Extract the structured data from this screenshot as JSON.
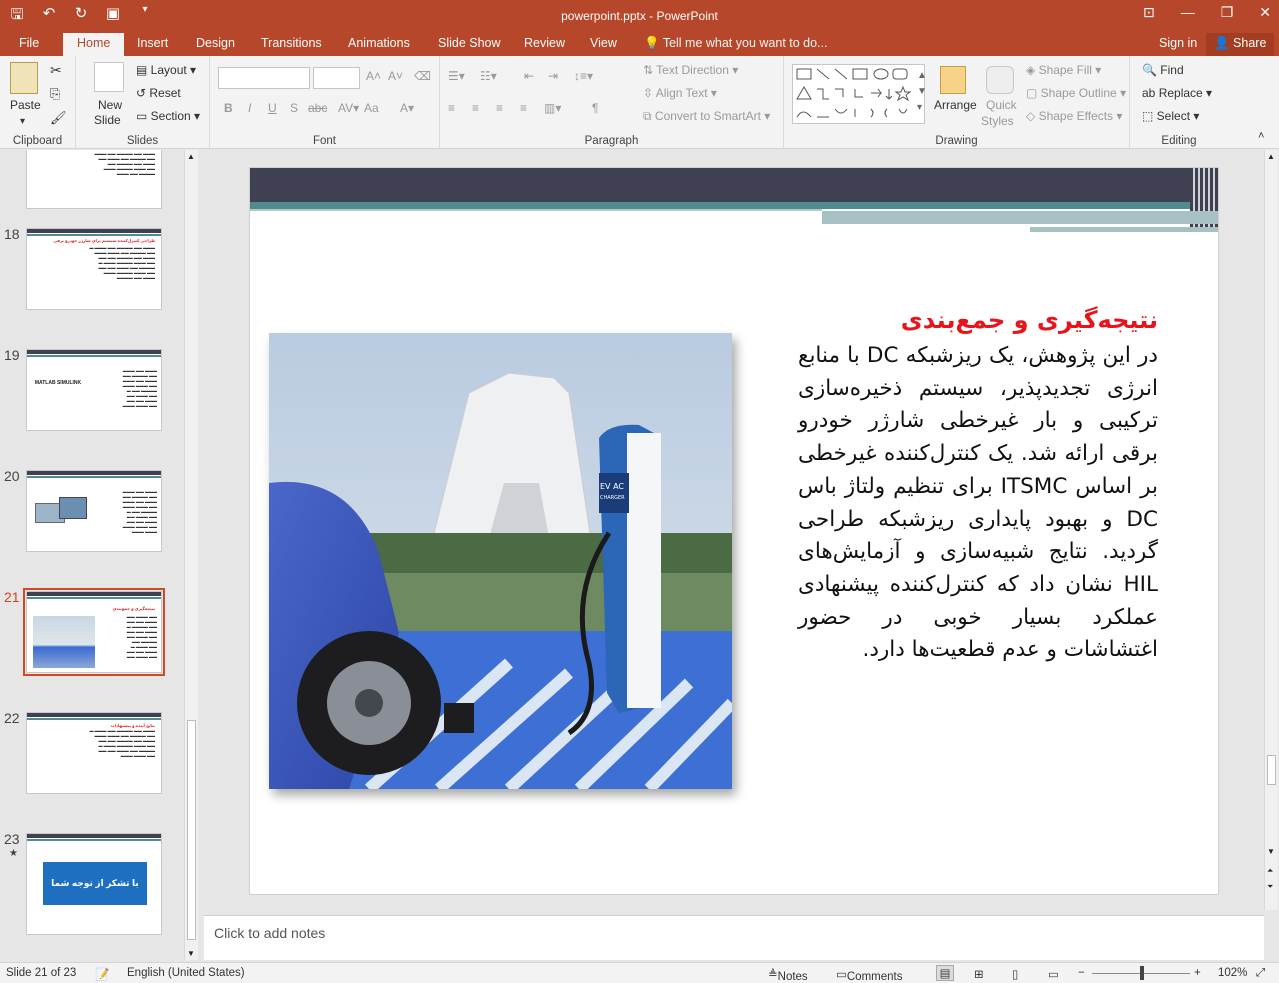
{
  "window": {
    "title": "powerpoint.pptx - PowerPoint"
  },
  "menu": {
    "tabs": [
      "File",
      "Home",
      "Insert",
      "Design",
      "Transitions",
      "Animations",
      "Slide Show",
      "Review",
      "View"
    ],
    "tell_me": "Tell me what you want to do...",
    "sign_in": "Sign in",
    "share": "Share"
  },
  "ribbon": {
    "clipboard": {
      "paste": "Paste",
      "label": "Clipboard"
    },
    "slides": {
      "new_slide": "New",
      "new_slide2": "Slide",
      "layout": "Layout",
      "reset": "Reset",
      "section": "Section",
      "label": "Slides"
    },
    "font": {
      "label": "Font",
      "bold": "B",
      "italic": "I",
      "underline": "U",
      "strike": "S",
      "spacing": "abc",
      "case": "Aa"
    },
    "paragraph": {
      "text_direction": "Text Direction",
      "align_text": "Align Text",
      "smartart": "Convert to SmartArt",
      "label": "Paragraph"
    },
    "drawing": {
      "arrange": "Arrange",
      "quick_styles": "Quick",
      "quick_styles2": "Styles",
      "shape_fill": "Shape Fill",
      "shape_outline": "Shape Outline",
      "shape_effects": "Shape Effects",
      "label": "Drawing"
    },
    "editing": {
      "find": "Find",
      "replace": "Replace",
      "select": "Select",
      "label": "Editing"
    }
  },
  "thumbnails": [
    {
      "num": "18",
      "title": "طراحی کنترل‌کننده سیستم برای شارژر خودرو برقی"
    },
    {
      "num": "19",
      "logo": "MATLAB SIMULINK"
    },
    {
      "num": "20"
    },
    {
      "num": "21",
      "title": "نتیجه‌گیری و جمع‌بندی"
    },
    {
      "num": "22",
      "title": "نتایج آینده و پیشنهادات"
    },
    {
      "num": "23",
      "star": "★",
      "box": "با تشکر از توجه شما"
    }
  ],
  "slide": {
    "heading": "نتیجه‌گیری و جمع‌بندی",
    "body": "در این پژوهش، یک ریزشبکه DC با منابع انرژی تجدیدپذیر، سیستم ذخیره‌سازی ترکیبی و بار غیرخطی شارژر خودرو برقی ارائه شد. یک کنترل‌کننده غیرخطی بر اساس ITSMC برای تنظیم ولتاژ باس DC و بهبود پایداری ریزشبکه طراحی گردید. نتایج شبیه‌سازی و آزمایش‌های HIL نشان داد که کنترل‌کننده پیشنهادی عملکرد بسیار خوبی در حضور اغتشاشات و عدم قطعیت‌ها دارد.",
    "charger_label": "EV AC",
    "charger_sub": "CHARGER"
  },
  "notes": {
    "placeholder": "Click to add notes"
  },
  "status": {
    "slide": "Slide 21 of 23",
    "language": "English (United States)",
    "notes": "Notes",
    "comments": "Comments",
    "zoom": "102%"
  },
  "colors": {
    "accent": "#b7472a",
    "heading_red": "#e8141c",
    "slide_dark": "#3f4152",
    "slide_teal": "#4f8b8f"
  }
}
